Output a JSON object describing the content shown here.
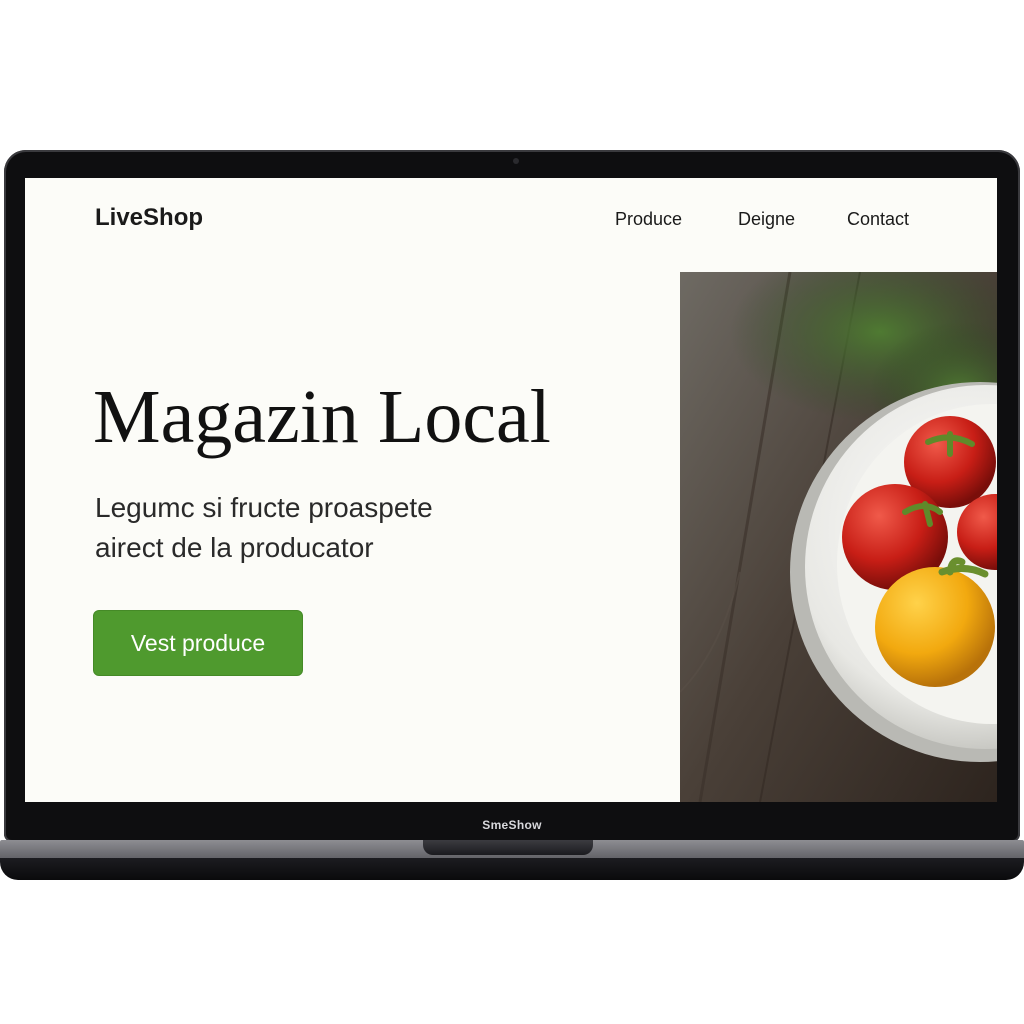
{
  "header": {
    "logo": "LiveShop",
    "nav": [
      {
        "label": "Produce"
      },
      {
        "label": "Deigne"
      },
      {
        "label": "Contact"
      }
    ]
  },
  "hero": {
    "title": "Magazin Local",
    "subtitle_lines": [
      "Legumc si fructe proaspete",
      "airect de la producator"
    ],
    "cta_label": "Vest produce",
    "image_alt": "bowl-of-tomatoes-photo"
  },
  "device": {
    "brand_label": "SmeShow"
  },
  "colors": {
    "accent": "#4f9a2e",
    "page_bg": "#fcfcf8",
    "text": "#111111"
  }
}
